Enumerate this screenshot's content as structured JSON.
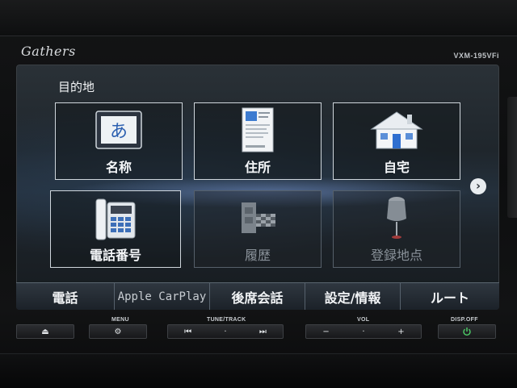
{
  "device": {
    "brand": "Gathers",
    "model": "VXM-195VFi"
  },
  "screen": {
    "title": "目的地",
    "tiles": [
      {
        "label": "名称",
        "icon": "hiragana-a-icon",
        "enabled": true
      },
      {
        "label": "住所",
        "icon": "address-card-icon",
        "enabled": true
      },
      {
        "label": "自宅",
        "icon": "house-icon",
        "enabled": true
      },
      {
        "label": "電話番号",
        "icon": "phone-icon",
        "enabled": true
      },
      {
        "label": "履歴",
        "icon": "history-flag-icon",
        "enabled": false
      },
      {
        "label": "登録地点",
        "icon": "pushpin-icon",
        "enabled": false
      }
    ],
    "next_icon": "chevron-right-icon",
    "bottom_nav": [
      {
        "label": "電話"
      },
      {
        "label": "Apple CarPlay"
      },
      {
        "label": "後席会話"
      },
      {
        "label": "設定/情報"
      },
      {
        "label": "ルート"
      }
    ]
  },
  "hardware": {
    "eject_label": "⏏",
    "menu_label": "MENU",
    "menu_icon": "gear-icon",
    "tune_track_label": "TUNE/TRACK",
    "prev_label": "⏮",
    "next_label": "⏭",
    "vol_label": "VOL",
    "vol_down_label": "−",
    "vol_up_label": "+",
    "disp_off_label": "DISP.OFF",
    "power_icon": "power-icon"
  }
}
